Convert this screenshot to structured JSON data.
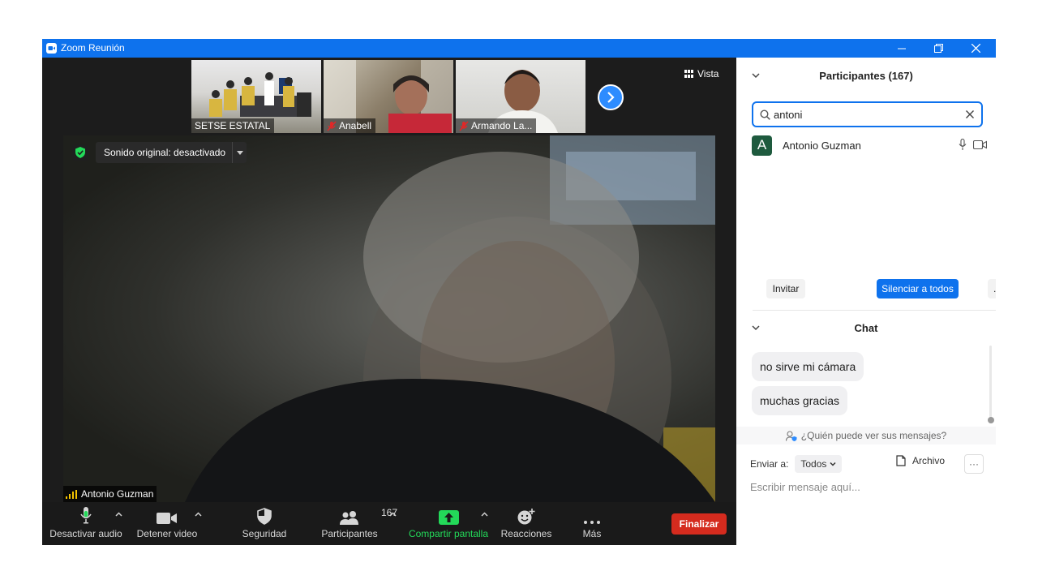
{
  "window": {
    "title": "Zoom Reunión"
  },
  "thumbnails": [
    {
      "name": "SETSE ESTATAL",
      "muted": false
    },
    {
      "name": "Anabell",
      "muted": true
    },
    {
      "name": "Armando La...",
      "muted": true
    }
  ],
  "view_label": "Vista",
  "sound_label": "Sonido original: desactivado",
  "speaker_name": "Antonio Guzman",
  "toolbar": {
    "audio": "Desactivar audio",
    "video": "Detener video",
    "security": "Seguridad",
    "participants": "Participantes",
    "participants_count": "167",
    "share": "Compartir pantalla",
    "reactions": "Reacciones",
    "more": "Más",
    "end": "Finalizar"
  },
  "participants_panel": {
    "title": "Participantes (167)",
    "search_value": "antoni",
    "results": [
      {
        "initial": "A",
        "name": "Antonio Guzman"
      }
    ],
    "invite": "Invitar",
    "mute_all": "Silenciar a todos",
    "more": "..."
  },
  "chat_panel": {
    "title": "Chat",
    "messages": [
      "no sirve mi cámara",
      "muchas gracias"
    ],
    "who_sees": "¿Quién puede ver sus mensajes?",
    "send_to_label": "Enviar a:",
    "send_to_value": "Todos",
    "file_label": "Archivo",
    "more": "···",
    "input_placeholder": "Escribir mensaje aquí..."
  },
  "colors": {
    "zoom_blue": "#0e72ed",
    "share_green": "#23d959",
    "end_red": "#d52b1e",
    "mute_red": "#e02828"
  }
}
